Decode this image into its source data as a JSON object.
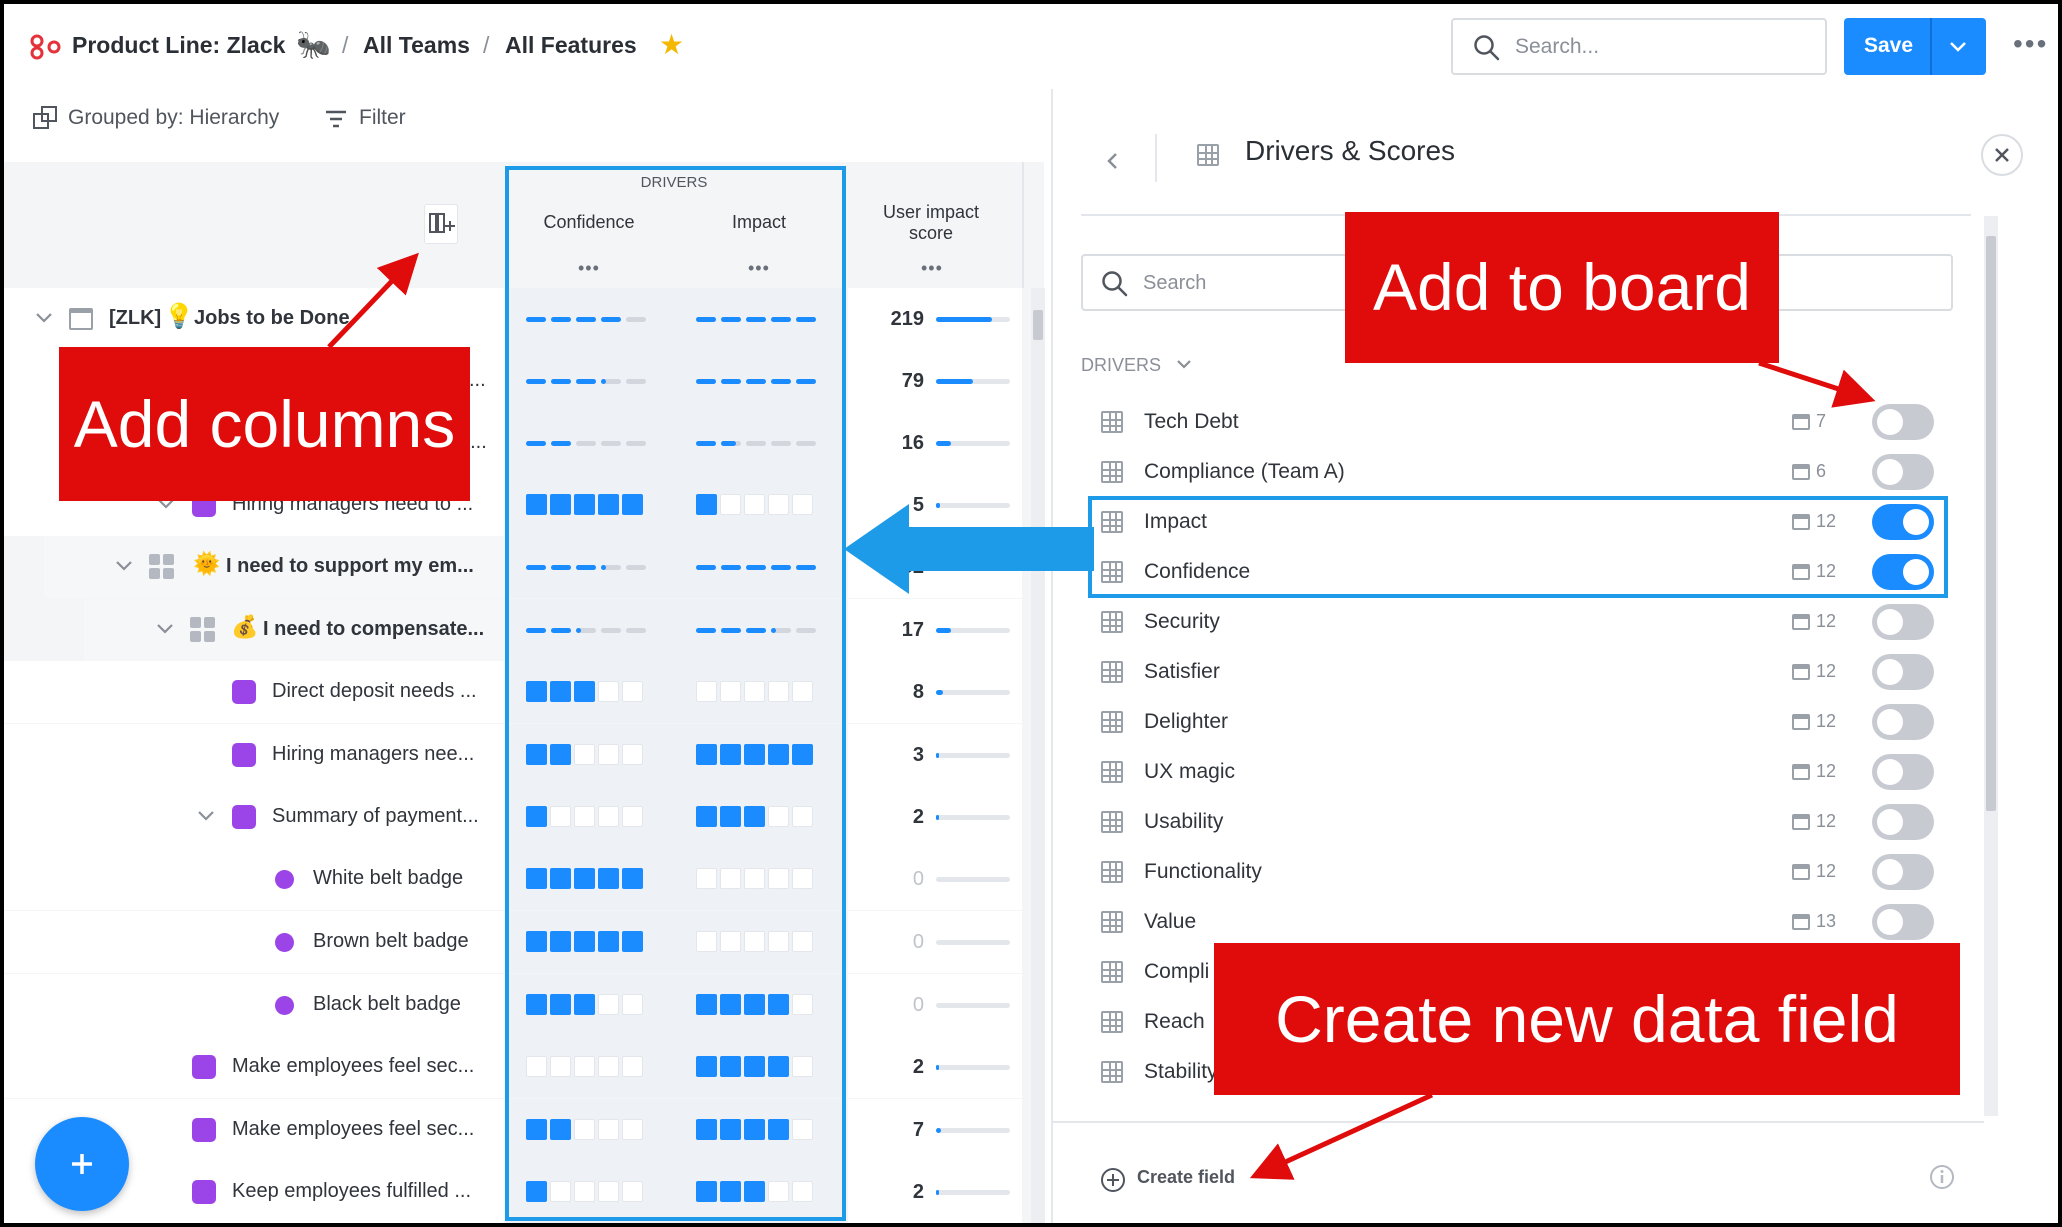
{
  "header": {
    "title": "Product Line: Zlack",
    "crumb1": "All Teams",
    "crumb2": "All Features",
    "search_placeholder": "Search...",
    "save_label": "Save"
  },
  "toolbar": {
    "grouped": "Grouped by: Hierarchy",
    "filter": "Filter"
  },
  "table": {
    "group_header": "DRIVERS",
    "col_confidence": "Confidence",
    "col_impact": "Impact",
    "col_user_impact": "User impact score",
    "dots": "•••",
    "rows": [
      {
        "name": "[ZLK]",
        "name2": "Jobs to be Done",
        "conf": {
          "kind": "dash",
          "value": 0.8
        },
        "imp": {
          "kind": "dash",
          "value": 1
        },
        "score": "219",
        "fill": 0.75
      },
      {
        "name": "s...",
        "conf": {
          "kind": "dash",
          "value": 0.65
        },
        "imp": {
          "kind": "dash",
          "value": 1
        },
        "score": "79",
        "fill": 0.5
      },
      {
        "name": "o...",
        "conf": {
          "kind": "dash",
          "value": 0.4
        },
        "imp": {
          "kind": "dash",
          "value": 0.35
        },
        "score": "16",
        "fill": 0.2
      },
      {
        "name": "Hiring managers need to ...",
        "conf": {
          "kind": "blocks",
          "value": 5
        },
        "imp": {
          "kind": "blocks",
          "value": 1
        },
        "score": "5",
        "fill": 0.05
      },
      {
        "name": "I need to support my em...",
        "conf": {
          "kind": "dash",
          "value": 0.65
        },
        "imp": {
          "kind": "dash",
          "value": 1
        },
        "score": "52",
        "fill": 0.45
      },
      {
        "name": "I need to compensate...",
        "conf": {
          "kind": "dash",
          "value": 0.45
        },
        "imp": {
          "kind": "dash",
          "value": 0.65
        },
        "score": "17",
        "fill": 0.2
      },
      {
        "name": "Direct deposit needs ...",
        "conf": {
          "kind": "blocks",
          "value": 3
        },
        "imp": {
          "kind": "blocks",
          "value": 0
        },
        "score": "8",
        "fill": 0.1
      },
      {
        "name": "Hiring managers nee...",
        "conf": {
          "kind": "blocks",
          "value": 2
        },
        "imp": {
          "kind": "blocks",
          "value": 5
        },
        "score": "3",
        "fill": 0.03
      },
      {
        "name": "Summary of payment...",
        "conf": {
          "kind": "blocks",
          "value": 1
        },
        "imp": {
          "kind": "blocks",
          "value": 3
        },
        "score": "2",
        "fill": 0.02
      },
      {
        "name": "White belt badge",
        "conf": {
          "kind": "blocks",
          "value": 5
        },
        "imp": {
          "kind": "blocks",
          "value": 0
        },
        "score": "0",
        "fill": 0
      },
      {
        "name": "Brown belt badge",
        "conf": {
          "kind": "blocks",
          "value": 5
        },
        "imp": {
          "kind": "blocks",
          "value": 0
        },
        "score": "0",
        "fill": 0
      },
      {
        "name": "Black belt badge",
        "conf": {
          "kind": "blocks",
          "value": 3
        },
        "imp": {
          "kind": "blocks",
          "value": 4
        },
        "score": "0",
        "fill": 0
      },
      {
        "name": "Make employees feel sec...",
        "conf": {
          "kind": "blocks",
          "value": 0
        },
        "imp": {
          "kind": "blocks",
          "value": 4
        },
        "score": "2",
        "fill": 0.02
      },
      {
        "name": "Make employees feel sec...",
        "conf": {
          "kind": "blocks",
          "value": 2
        },
        "imp": {
          "kind": "blocks",
          "value": 4
        },
        "score": "7",
        "fill": 0.07
      },
      {
        "name": "Keep employees fulfilled ...",
        "conf": {
          "kind": "blocks",
          "value": 1
        },
        "imp": {
          "kind": "blocks",
          "value": 3
        },
        "score": "2",
        "fill": 0.02
      }
    ]
  },
  "panel": {
    "title": "Drivers & Scores",
    "search_placeholder": "Search",
    "section_label": "DRIVERS",
    "items": [
      {
        "name": "Tech Debt",
        "count": "7",
        "on": false
      },
      {
        "name": "Compliance (Team A)",
        "count": "6",
        "on": false
      },
      {
        "name": "Impact",
        "count": "12",
        "on": true
      },
      {
        "name": "Confidence",
        "count": "12",
        "on": true
      },
      {
        "name": "Security",
        "count": "12",
        "on": false
      },
      {
        "name": "Satisfier",
        "count": "12",
        "on": false
      },
      {
        "name": "Delighter",
        "count": "12",
        "on": false
      },
      {
        "name": "UX magic",
        "count": "12",
        "on": false
      },
      {
        "name": "Usability",
        "count": "12",
        "on": false
      },
      {
        "name": "Functionality",
        "count": "12",
        "on": false
      },
      {
        "name": "Value",
        "count": "13",
        "on": false
      },
      {
        "name": "Compli",
        "count": "",
        "on": null
      },
      {
        "name": "Reach",
        "count": "",
        "on": null
      },
      {
        "name": "Stability",
        "count": "",
        "on": null
      }
    ],
    "create_field": "Create field"
  },
  "annotations": {
    "add_columns": "Add columns",
    "add_to_board": "Add to board",
    "create_new": "Create new data field"
  },
  "colors": {
    "accent": "#1a8cff",
    "purple": "#9b45e8",
    "annotation_red": "#e00b0b",
    "annotation_blue": "#1e9be8"
  }
}
